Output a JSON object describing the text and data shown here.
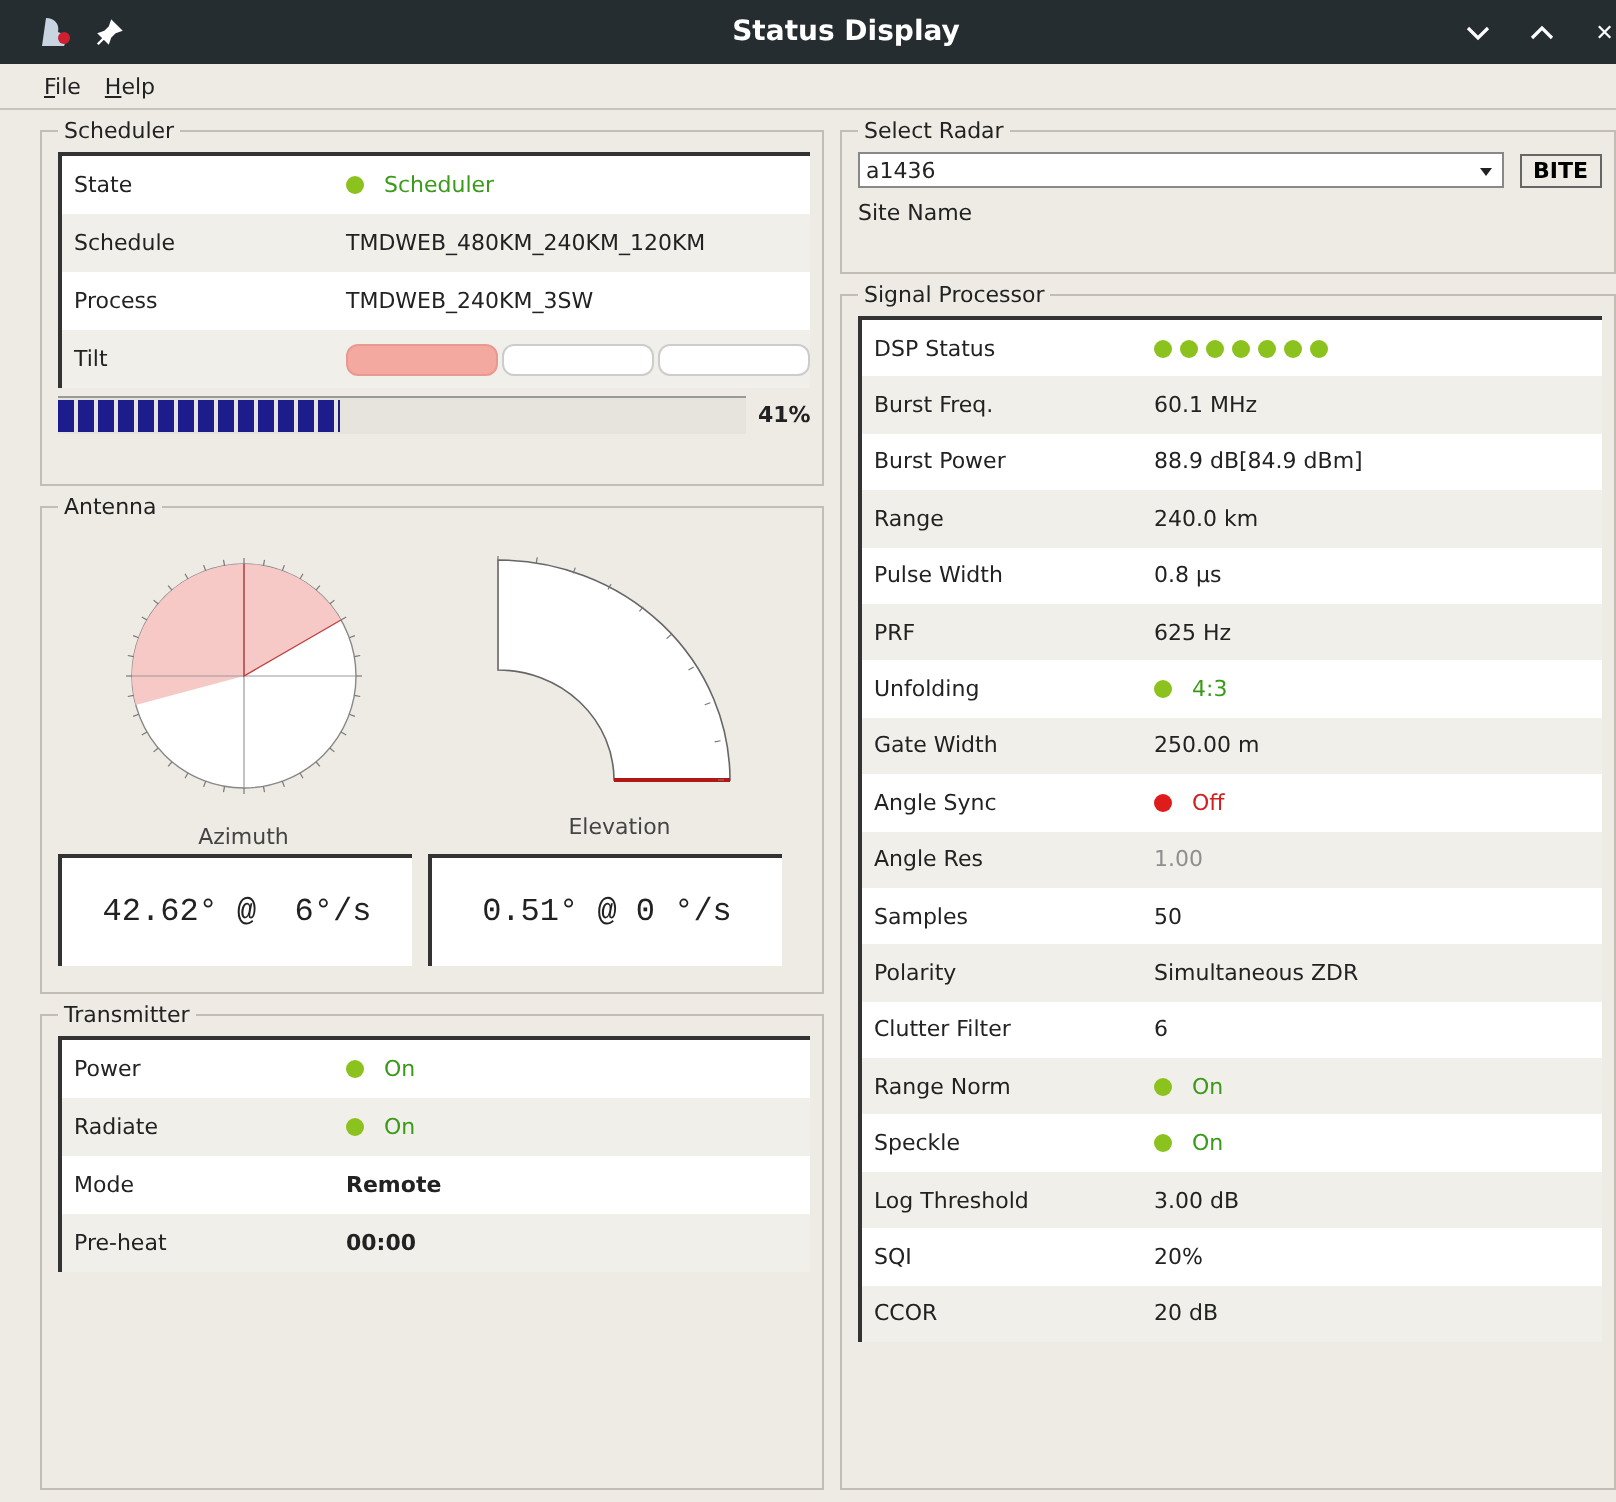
{
  "window": {
    "title": "Status Display"
  },
  "menu": [
    {
      "label": "File"
    },
    {
      "label": "Help"
    }
  ],
  "scheduler": {
    "title": "Scheduler",
    "rows": [
      {
        "label": "State",
        "kind": "status",
        "value": "Scheduler",
        "on": true
      },
      {
        "label": "Schedule",
        "kind": "text",
        "value": "TMDWEB_480KM_240KM_120KM"
      },
      {
        "label": "Process",
        "kind": "text",
        "value": "TMDWEB_240KM_3SW"
      },
      {
        "label": "Tilt",
        "kind": "tilt",
        "segments": [
          {
            "active": true
          },
          {
            "active": false
          },
          {
            "active": false
          }
        ]
      }
    ],
    "progress": {
      "level": 0.41,
      "reading": "41%"
    }
  },
  "antenna": {
    "title": "Antenna",
    "azimuth": {
      "label": "Azimuth",
      "reading": "42.62° @  6°/s"
    },
    "elevation": {
      "label": "Elevation",
      "reading": "0.51° @ 0 °/s"
    }
  },
  "transmitter": {
    "title": "Transmitter",
    "rows": [
      {
        "label": "Power",
        "kind": "status",
        "value": "On",
        "on": true
      },
      {
        "label": "Radiate",
        "kind": "status",
        "value": "On",
        "on": true
      },
      {
        "label": "Mode",
        "kind": "bold",
        "value": "Remote"
      },
      {
        "label": "Pre-heat",
        "kind": "bold",
        "value": "00:00"
      }
    ]
  },
  "select_radar": {
    "title": "Select Radar",
    "value": "a1436",
    "button": "BITE",
    "site_name_label": "Site Name"
  },
  "signal_processor": {
    "title": "Signal Processor",
    "rows": [
      {
        "label": "DSP Status",
        "kind": "dots",
        "indicators": [
          {
            "on": true
          },
          {
            "on": true
          },
          {
            "on": true
          },
          {
            "on": true
          },
          {
            "on": true
          },
          {
            "on": true
          },
          {
            "on": true
          }
        ]
      },
      {
        "label": "Burst Freq.",
        "kind": "text",
        "value": "60.1 MHz"
      },
      {
        "label": "Burst Power",
        "kind": "text",
        "value": "88.9 dB[84.9 dBm]"
      },
      {
        "label": "Range",
        "kind": "text",
        "value": "240.0 km"
      },
      {
        "label": "Pulse Width",
        "kind": "text",
        "value": "0.8 µs"
      },
      {
        "label": "PRF",
        "kind": "text",
        "value": "625 Hz"
      },
      {
        "label": "Unfolding",
        "kind": "status",
        "value": "4:3",
        "on": true
      },
      {
        "label": "Gate Width",
        "kind": "text",
        "value": "250.00 m"
      },
      {
        "label": "Angle Sync",
        "kind": "status",
        "value": "Off",
        "on": false
      },
      {
        "label": "Angle Res",
        "kind": "text",
        "value": "1.00",
        "disabled": true
      },
      {
        "label": "Samples",
        "kind": "text",
        "value": "50"
      },
      {
        "label": "Polarity",
        "kind": "text",
        "value": "Simultaneous ZDR"
      },
      {
        "label": "Clutter Filter",
        "kind": "text",
        "value": "6"
      },
      {
        "label": "Range Norm",
        "kind": "status",
        "value": "On",
        "on": true
      },
      {
        "label": "Speckle",
        "kind": "status",
        "value": "On",
        "on": true
      },
      {
        "label": "Log Threshold",
        "kind": "text",
        "value": "3.00 dB"
      },
      {
        "label": "SQI",
        "kind": "text",
        "value": "20%"
      },
      {
        "label": "CCOR",
        "kind": "text",
        "value": "20 dB"
      }
    ]
  }
}
